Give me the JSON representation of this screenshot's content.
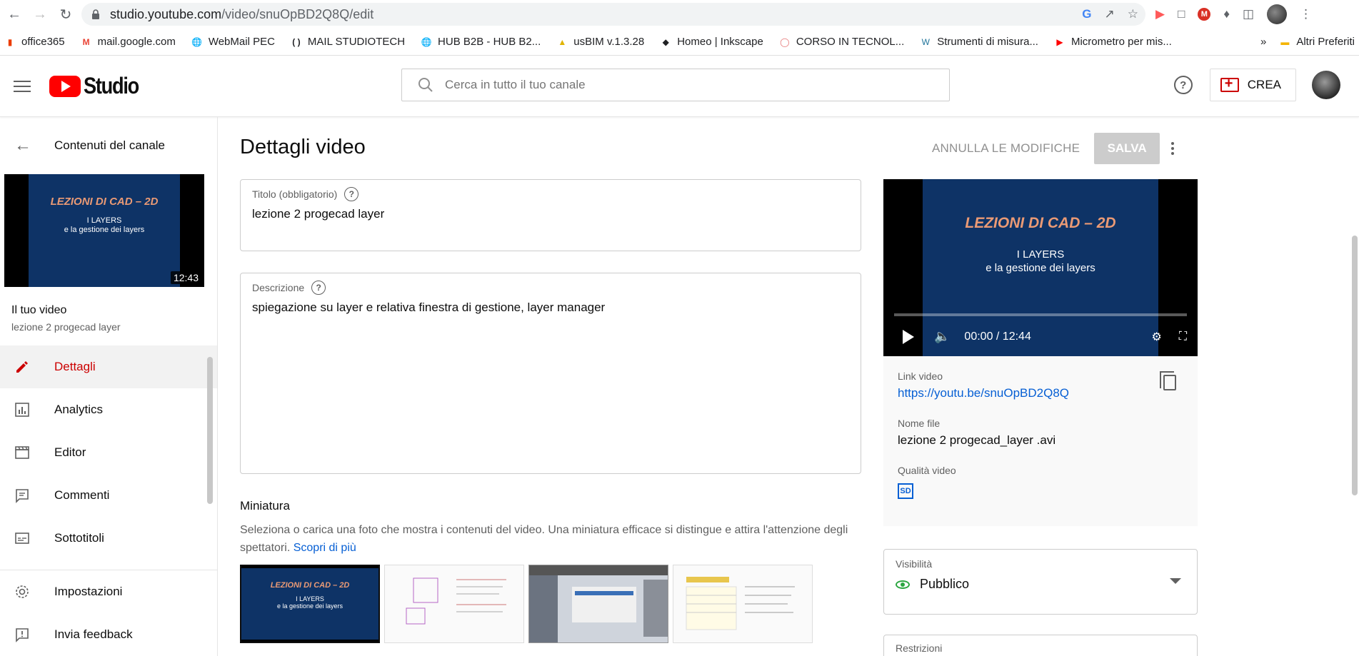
{
  "browser": {
    "url_host": "studio.youtube.com",
    "url_path": "/video/snuOpBD2Q8Q/edit",
    "bookmarks": [
      {
        "label": "office365"
      },
      {
        "label": "mail.google.com"
      },
      {
        "label": "WebMail PEC"
      },
      {
        "label": "MAIL STUDIOTECH"
      },
      {
        "label": "HUB B2B - HUB B2..."
      },
      {
        "label": "usBIM v.1.3.28"
      },
      {
        "label": "Homeo | Inkscape"
      },
      {
        "label": "CORSO IN TECNOL..."
      },
      {
        "label": "Strumenti di misura..."
      },
      {
        "label": "Micrometro per mis..."
      }
    ],
    "bookmarks_more": "»",
    "other_bookmarks": "Altri Preferiti"
  },
  "header": {
    "logo_text": "Studio",
    "search_placeholder": "Cerca in tutto il tuo canale",
    "create_label": "CREA"
  },
  "sidebar": {
    "back_label": "Contenuti del canale",
    "thumb_title": "LEZIONI DI CAD – 2D",
    "thumb_sub1": "I LAYERS",
    "thumb_sub2": "e la gestione dei layers",
    "thumb_duration": "12:43",
    "your_video_heading": "Il tuo video",
    "your_video_title": "lezione 2 progecad layer",
    "nav": [
      {
        "label": "Dettagli",
        "active": true
      },
      {
        "label": "Analytics"
      },
      {
        "label": "Editor"
      },
      {
        "label": "Commenti"
      },
      {
        "label": "Sottotitoli"
      }
    ],
    "bottom_nav": [
      {
        "label": "Impostazioni"
      },
      {
        "label": "Invia feedback"
      }
    ]
  },
  "main": {
    "page_title": "Dettagli video",
    "undo_label": "ANNULLA LE MODIFICHE",
    "save_label": "SALVA",
    "title_field": {
      "label": "Titolo (obbligatorio)",
      "value": "lezione 2 progecad layer"
    },
    "desc_field": {
      "label": "Descrizione",
      "value": "spiegazione su layer e relativa finestra di gestione, layer manager"
    },
    "thumbnail_section": {
      "title": "Miniatura",
      "desc": "Seleziona o carica una foto che mostra i contenuti del video. Una miniatura efficace si distingue e attira l'attenzione degli spettatori.",
      "link": "Scopri di più"
    }
  },
  "right_panel": {
    "player_title": "LEZIONI DI CAD – 2D",
    "player_sub1": "I LAYERS",
    "player_sub2": "e la gestione dei layers",
    "time": "00:00 / 12:44",
    "link_label": "Link video",
    "link_value": "https://youtu.be/snuOpBD2Q8Q",
    "file_label": "Nome file",
    "file_value": "lezione 2 progecad_layer .avi",
    "quality_label": "Qualità video",
    "quality_badge": "SD",
    "visibility_label": "Visibilità",
    "visibility_value": "Pubblico",
    "restrictions_label": "Restrizioni"
  },
  "colors": {
    "accent_red": "#cc0000",
    "link_blue": "#065fd4",
    "public_green": "#2ba640"
  }
}
